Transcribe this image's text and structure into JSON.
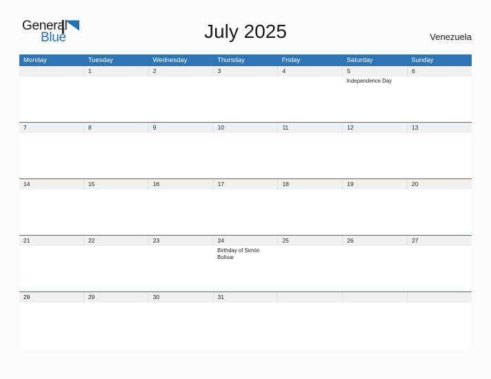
{
  "brand": {
    "line1": "General",
    "line2": "Blue",
    "mark": "triangle-flag-icon",
    "accent_color": "#2072b8"
  },
  "header": {
    "title": "July 2025",
    "region": "Venezuela"
  },
  "theme": {
    "header_blue": "#2e75b6",
    "date_band_gray": "#f0f0f0",
    "page_background": "#fbfbfb",
    "text_color": "#222222"
  },
  "calendar": {
    "weekdays": [
      "Monday",
      "Tuesday",
      "Wednesday",
      "Thursday",
      "Friday",
      "Saturday",
      "Sunday"
    ],
    "weeks": [
      {
        "days": [
          {
            "date": "",
            "events": []
          },
          {
            "date": "1",
            "events": []
          },
          {
            "date": "2",
            "events": []
          },
          {
            "date": "3",
            "events": []
          },
          {
            "date": "4",
            "events": []
          },
          {
            "date": "5",
            "events": [
              "Independence Day"
            ]
          },
          {
            "date": "6",
            "events": []
          }
        ]
      },
      {
        "days": [
          {
            "date": "7",
            "events": []
          },
          {
            "date": "8",
            "events": []
          },
          {
            "date": "9",
            "events": []
          },
          {
            "date": "10",
            "events": []
          },
          {
            "date": "11",
            "events": []
          },
          {
            "date": "12",
            "events": []
          },
          {
            "date": "13",
            "events": []
          }
        ]
      },
      {
        "days": [
          {
            "date": "14",
            "events": []
          },
          {
            "date": "15",
            "events": []
          },
          {
            "date": "16",
            "events": []
          },
          {
            "date": "17",
            "events": []
          },
          {
            "date": "18",
            "events": []
          },
          {
            "date": "19",
            "events": []
          },
          {
            "date": "20",
            "events": []
          }
        ]
      },
      {
        "days": [
          {
            "date": "21",
            "events": []
          },
          {
            "date": "22",
            "events": []
          },
          {
            "date": "23",
            "events": []
          },
          {
            "date": "24",
            "events": [
              "Birthday of Simón Bolívar"
            ]
          },
          {
            "date": "25",
            "events": []
          },
          {
            "date": "26",
            "events": []
          },
          {
            "date": "27",
            "events": []
          }
        ]
      },
      {
        "days": [
          {
            "date": "28",
            "events": []
          },
          {
            "date": "29",
            "events": []
          },
          {
            "date": "30",
            "events": []
          },
          {
            "date": "31",
            "events": []
          },
          {
            "date": "",
            "events": []
          },
          {
            "date": "",
            "events": []
          },
          {
            "date": "",
            "events": []
          }
        ]
      }
    ]
  }
}
